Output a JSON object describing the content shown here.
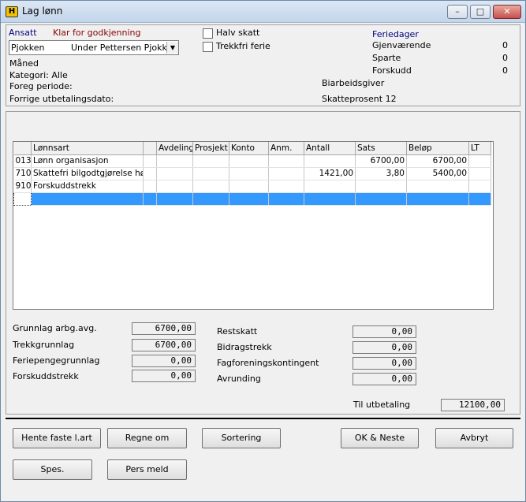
{
  "window": {
    "title": "Lag lønn",
    "icon_letter": "H"
  },
  "employee": {
    "label": "Ansatt",
    "status": "Klar for godkjenning",
    "name_value": "Pjokken",
    "dropdown_value": "Under Pettersen Pjokken"
  },
  "options": {
    "halv_skatt": "Halv skatt",
    "trekkfri_ferie": "Trekkfri ferie"
  },
  "info": {
    "maned": "Måned",
    "kategori": "Kategori: Alle",
    "foreg_periode": "Foreg periode:",
    "forrige_utbetaling": "Forrige utbetalingsdato:",
    "biarbeidsgiver": "Biarbeidsgiver",
    "skatteprosent": "Skatteprosent 12"
  },
  "feriedager": {
    "title": "Feriedager",
    "gjenvaerende_label": "Gjenværende",
    "gjenvaerende_value": "0",
    "sparte_label": "Sparte",
    "sparte_value": "0",
    "forskudd_label": "Forskudd",
    "forskudd_value": "0"
  },
  "grid": {
    "headers": [
      "Lønnsart",
      "",
      "Avdeling",
      "Prosjekt",
      "Konto",
      "Anm.",
      "Antall",
      "Sats",
      "Beløp",
      "LT"
    ],
    "rows": [
      {
        "code": "013",
        "name": "Lønn organisasjon",
        "antall": "",
        "sats": "6700,00",
        "belop": "6700,00"
      },
      {
        "code": "710",
        "name": "Skattefri bilgodtgjørelse høy",
        "antall": "1421,00",
        "sats": "3,80",
        "belop": "5400,00"
      },
      {
        "code": "910",
        "name": "Forskuddstrekk",
        "antall": "",
        "sats": "",
        "belop": ""
      }
    ]
  },
  "totals_left": {
    "grunnlag_label": "Grunnlag arbg.avg.",
    "grunnlag_value": "6700,00",
    "trekkgrunnlag_label": "Trekkgrunnlag",
    "trekkgrunnlag_value": "6700,00",
    "feriepenge_label": "Feriepengegrunnlag",
    "feriepenge_value": "0,00",
    "forskudd_label": "Forskuddstrekk",
    "forskudd_value": "0,00"
  },
  "totals_right": {
    "restskatt_label": "Restskatt",
    "restskatt_value": "0,00",
    "bidrag_label": "Bidragstrekk",
    "bidrag_value": "0,00",
    "fagforening_label": "Fagforeningskontingent",
    "fagforening_value": "0,00",
    "avrunding_label": "Avrunding",
    "avrunding_value": "0,00",
    "utbetaling_label": "Til utbetaling",
    "utbetaling_value": "12100,00"
  },
  "buttons": {
    "hente": "Hente faste l.art",
    "regne": "Regne om",
    "sortering": "Sortering",
    "ok_neste": "OK & Neste",
    "avbryt": "Avbryt",
    "spes": "Spes.",
    "pers_meld": "Pers meld"
  },
  "colors": {
    "status_red": "#8b0000",
    "feriedager_blue": "#000080",
    "selection": "#3399ff"
  }
}
